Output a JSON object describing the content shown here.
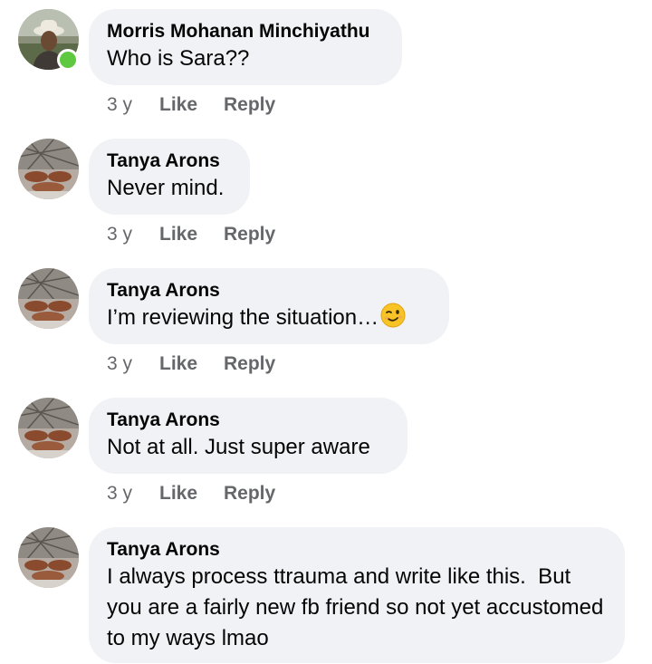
{
  "comments": [
    {
      "author": "Morris Mohanan Minchiyathu",
      "text": "Who is Sara??",
      "time": "3 y",
      "like": "Like",
      "reply": "Reply",
      "online": true
    },
    {
      "author": "Tanya Arons",
      "text": "Never mind.",
      "time": "3 y",
      "like": "Like",
      "reply": "Reply"
    },
    {
      "author": "Tanya Arons",
      "text": "I’m reviewing the situation…",
      "emoji": "winking-face",
      "time": "3 y",
      "like": "Like",
      "reply": "Reply"
    },
    {
      "author": "Tanya Arons",
      "text": "Not at all. Just super aware",
      "time": "3 y",
      "like": "Like",
      "reply": "Reply"
    },
    {
      "author": "Tanya Arons",
      "text": "I always process ttrauma and write like this.  But you are a fairly new fb friend so not yet accustomed to my ways lmao"
    }
  ],
  "colors": {
    "bubble": "#f0f2f5",
    "meta_text": "#65676b",
    "online_dot": "#5ec840"
  }
}
